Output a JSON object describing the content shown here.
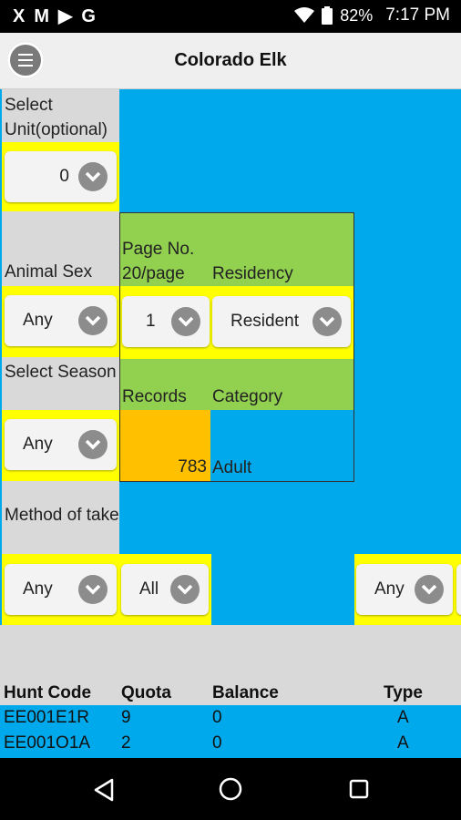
{
  "statusbar": {
    "apps": [
      "X",
      "M",
      "▶",
      "G"
    ],
    "battery": "82%",
    "time": "7:17 PM"
  },
  "appbar": {
    "title": "Colorado Elk"
  },
  "filters": {
    "unit": {
      "label": "Select Unit(optional)",
      "value": "0"
    },
    "animal_sex": {
      "label": "Animal Sex",
      "value": "Any"
    },
    "page_no": {
      "label": "Page No. 20/page",
      "value": "1"
    },
    "residency": {
      "label": "Residency",
      "value": "Resident"
    },
    "season": {
      "label": "Select Season",
      "value": "Any"
    },
    "records": {
      "label": "Records",
      "value": "783"
    },
    "category": {
      "label": "Category",
      "value": "Adult"
    },
    "method": {
      "label": "Method of take",
      "value": "Any"
    },
    "method2": {
      "value": "All"
    },
    "type_filter": {
      "value": "Any"
    }
  },
  "table": {
    "headers": [
      "Hunt Code",
      "Quota",
      "Balance",
      "Type"
    ],
    "rows": [
      [
        "EE001E1R",
        "9",
        "0",
        "A"
      ],
      [
        "EE001O1A",
        "2",
        "0",
        "A"
      ]
    ]
  }
}
